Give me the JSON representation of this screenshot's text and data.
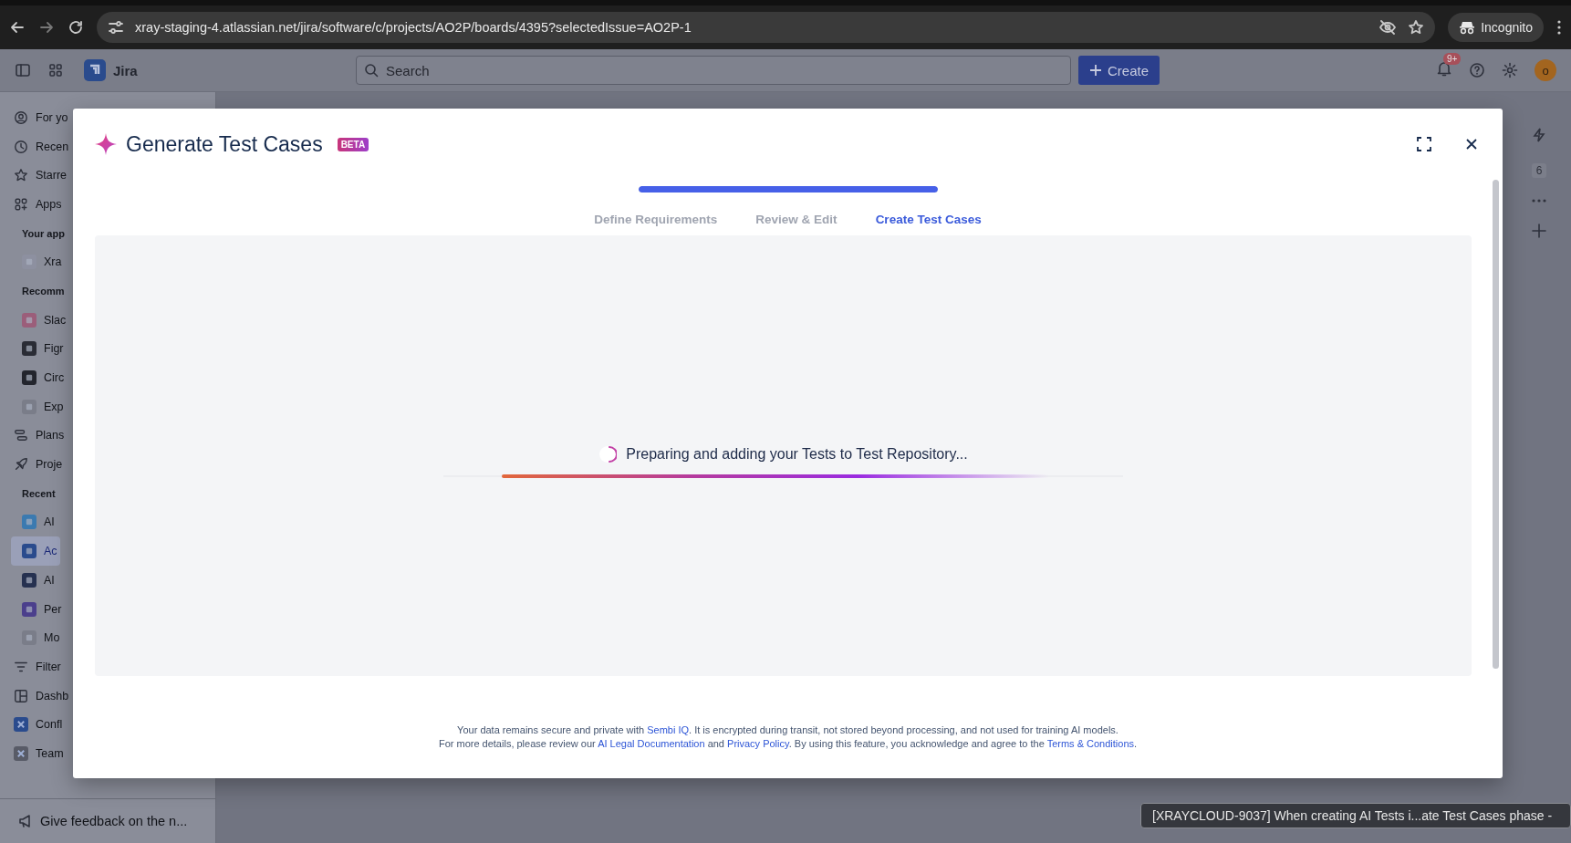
{
  "browser": {
    "url": "xray-staging-4.atlassian.net/jira/software/c/projects/AO2P/boards/4395?selectedIssue=AO2P-1",
    "profile": "Incognito"
  },
  "topbar": {
    "product": "Jira",
    "search": {
      "placeholder": "Search"
    },
    "create": "Create",
    "notifications": "9+",
    "avatar": "o"
  },
  "sidebar": {
    "items": [
      {
        "kind": "nav",
        "label": "For yo",
        "selected": false
      },
      {
        "kind": "nav",
        "label": "Recen",
        "selected": false
      },
      {
        "kind": "nav",
        "label": "Starre",
        "selected": false
      },
      {
        "kind": "nav",
        "label": "Apps",
        "selected": false
      },
      {
        "kind": "heading",
        "label": "Your app"
      },
      {
        "kind": "sub",
        "label": "Xra",
        "selected": false
      },
      {
        "kind": "heading",
        "label": "Recomm"
      },
      {
        "kind": "sub",
        "label": "Slac",
        "selected": false
      },
      {
        "kind": "sub",
        "label": "Figr",
        "selected": false
      },
      {
        "kind": "sub",
        "label": "Circ",
        "selected": false
      },
      {
        "kind": "sub",
        "label": "Exp",
        "selected": false
      },
      {
        "kind": "nav",
        "label": "Plans",
        "selected": false
      },
      {
        "kind": "nav",
        "label": "Proje",
        "selected": false
      },
      {
        "kind": "heading",
        "label": "Recent"
      },
      {
        "kind": "sub",
        "label": "AI",
        "selected": false
      },
      {
        "kind": "sub",
        "label": "Ac",
        "selected": true
      },
      {
        "kind": "sub",
        "label": "AI",
        "selected": false
      },
      {
        "kind": "sub",
        "label": "Per",
        "selected": false
      },
      {
        "kind": "sub",
        "label": "Mo",
        "selected": false
      },
      {
        "kind": "nav",
        "label": "Filter",
        "selected": false
      },
      {
        "kind": "nav",
        "label": "Dashb",
        "selected": false
      },
      {
        "kind": "nav",
        "label": "Confl",
        "selected": false
      },
      {
        "kind": "nav",
        "label": "Team",
        "selected": false
      }
    ],
    "feedback": "Give feedback on the n..."
  },
  "board": {
    "count": "6"
  },
  "modal": {
    "title": "Generate Test Cases",
    "badge": "BETA",
    "stepper": {
      "level": 1,
      "steps": [
        {
          "label": "Define Requirements",
          "selected": false
        },
        {
          "label": "Review & Edit",
          "selected": false
        },
        {
          "label": "Create Test Cases",
          "selected": true
        }
      ]
    },
    "status": "Preparing and adding your Tests to Test Repository...",
    "footer": [
      [
        {
          "text": "Your data remains secure and private with ",
          "link": false
        },
        {
          "text": "Sembi IQ",
          "link": true
        },
        {
          "text": ". It is encrypted during transit, not stored beyond processing, and not used for training AI models.",
          "link": false
        }
      ],
      [
        {
          "text": "For more details, please review our ",
          "link": false
        },
        {
          "text": "AI Legal Documentation",
          "link": true
        },
        {
          "text": " and ",
          "link": false
        },
        {
          "text": "Privacy Policy",
          "link": true
        },
        {
          "text": ". By using this feature, you acknowledge and agree to the ",
          "link": false
        },
        {
          "text": "Terms & Conditions",
          "link": true
        },
        {
          "text": ".",
          "link": false
        }
      ]
    ]
  },
  "tooltip": "[XRAYCLOUD-9037] When creating AI Tests i...ate Test Cases phase -"
}
